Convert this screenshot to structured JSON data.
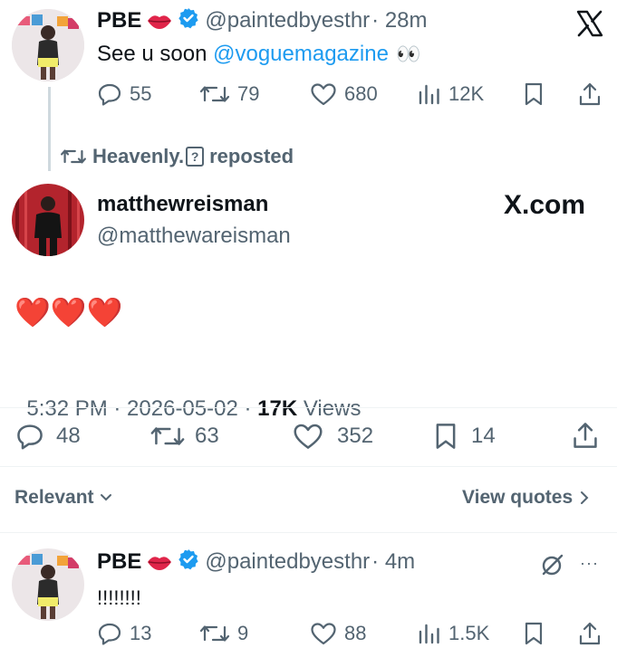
{
  "tweet1": {
    "name": "PBE",
    "handle": "@paintedbyesthr",
    "time": "· 28m",
    "text_prefix": "See u soon ",
    "mention": "@voguemagazine",
    "emoji": "👀",
    "replies": "55",
    "reposts": "79",
    "likes": "680",
    "views": "12K"
  },
  "repost_label": {
    "user": "Heavenly.",
    "suffix": "reposted"
  },
  "main_tweet": {
    "name": "matthewreisman",
    "handle": "@matthewareisman",
    "source": "X.com",
    "text": "❤️❤️❤️",
    "time": "5:32 PM · 2026-05-02 · ",
    "views_count": "17K",
    "views_label": " Views",
    "replies": "48",
    "reposts": "63",
    "likes": "352",
    "bookmarks": "14"
  },
  "sort": {
    "label": "Relevant",
    "view_quotes": "View quotes"
  },
  "reply": {
    "name": "PBE",
    "handle": "@paintedbyesthr",
    "time": "· 4m",
    "text": "!!!!!!!!",
    "replies": "13",
    "reposts": "9",
    "likes": "88",
    "views": "1.5K"
  },
  "colors": {
    "accent": "#1d9bf0",
    "muted": "#536471",
    "text": "#0f1419"
  }
}
